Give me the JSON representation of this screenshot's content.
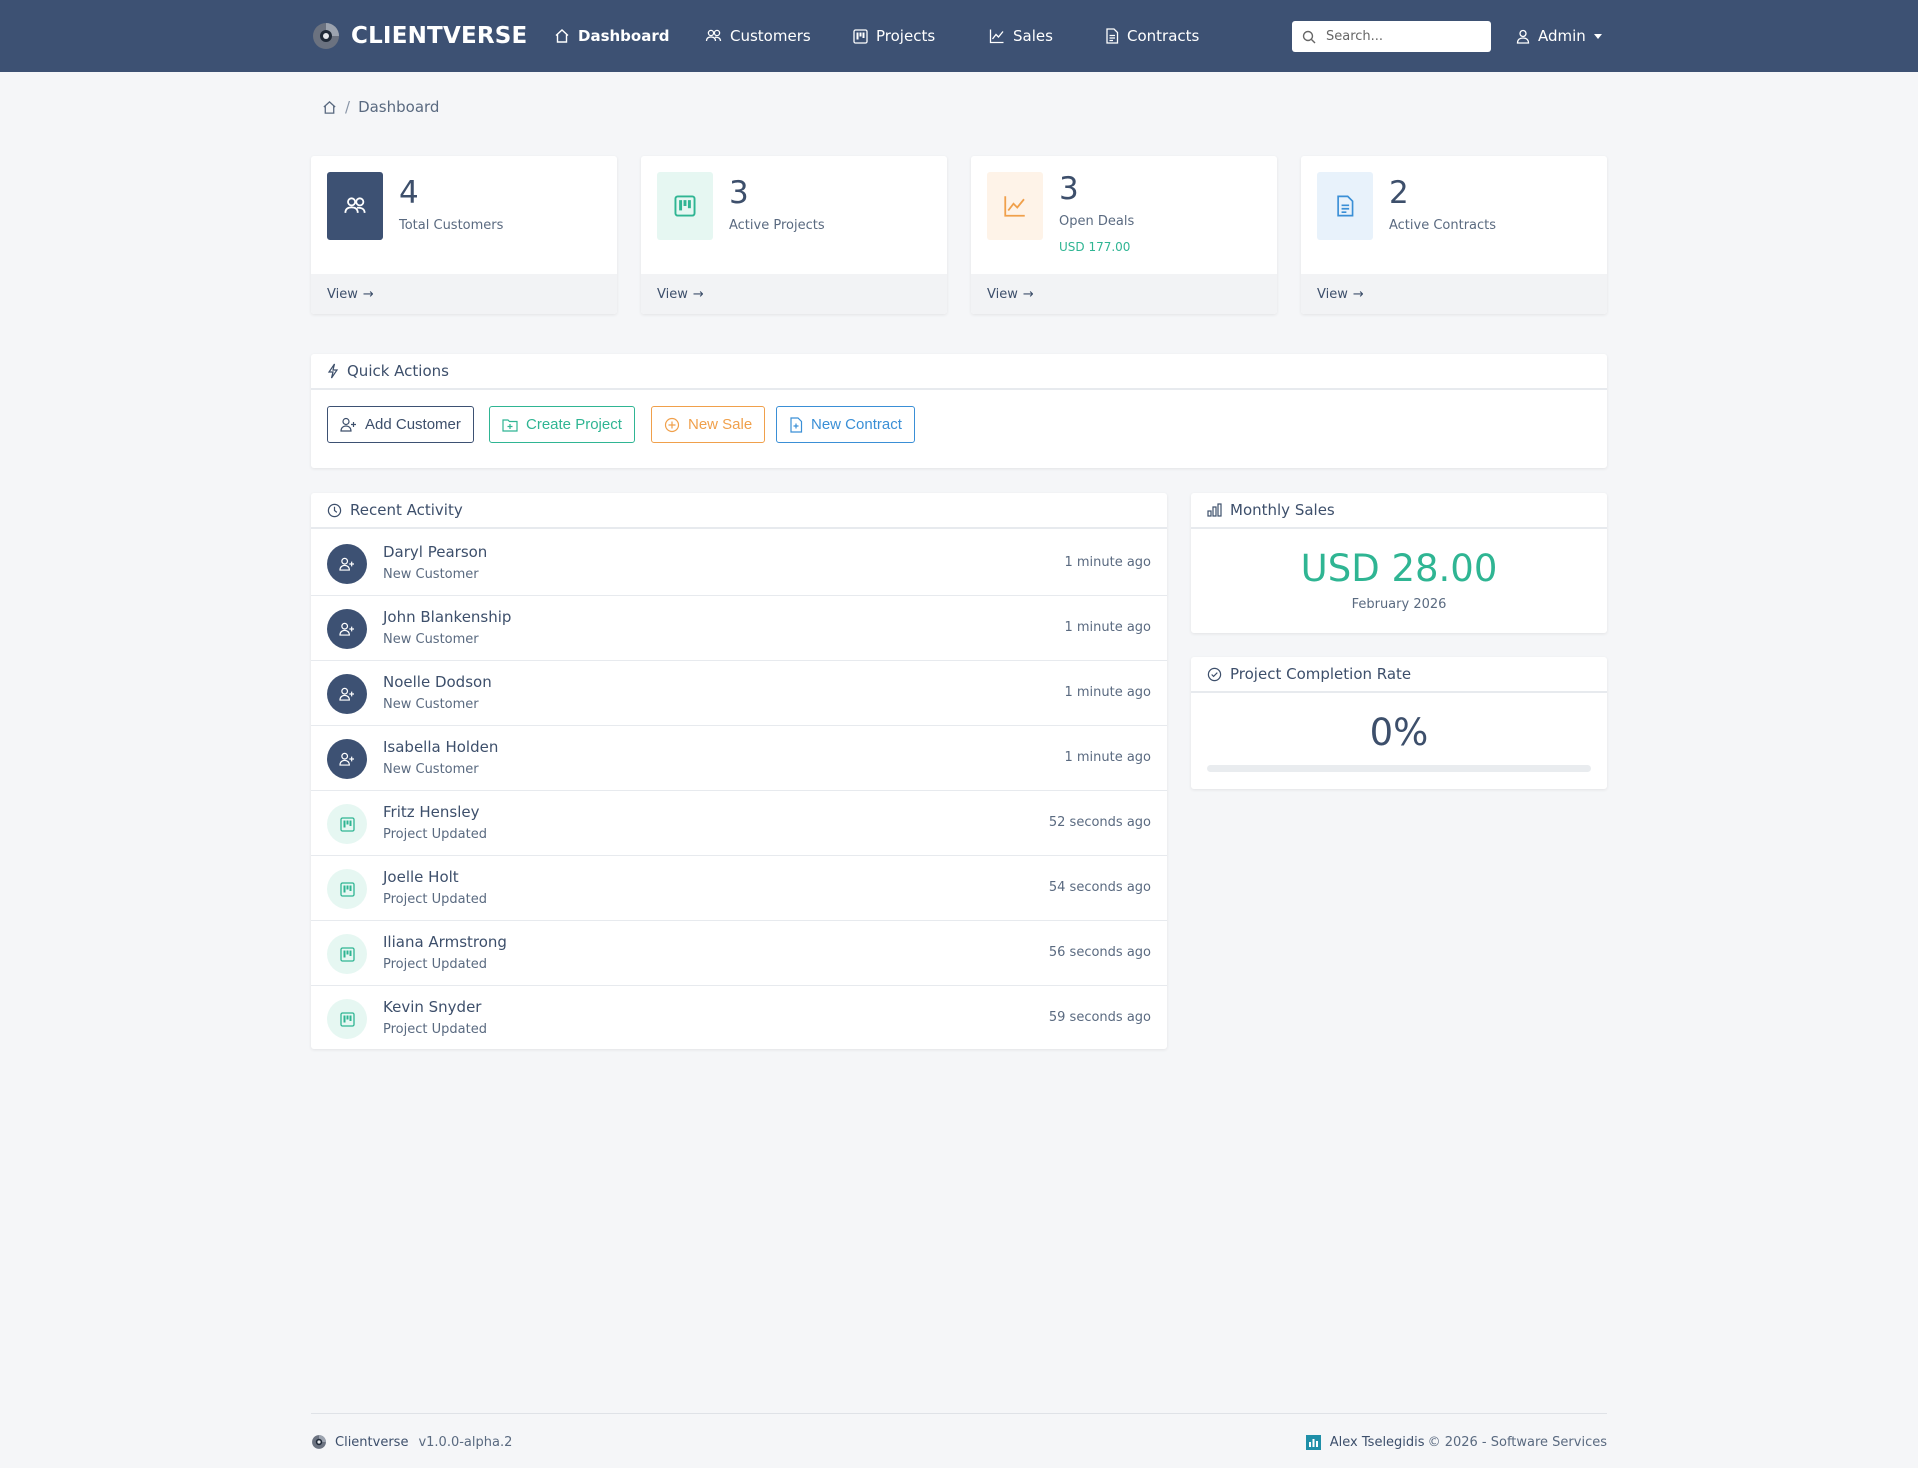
{
  "app": {
    "brand": "CLIENTVERSE",
    "nav": [
      {
        "label": "Dashboard",
        "icon": "home-icon",
        "active": true
      },
      {
        "label": "Customers",
        "icon": "users-icon"
      },
      {
        "label": "Projects",
        "icon": "kanban-icon"
      },
      {
        "label": "Sales",
        "icon": "chart-line-icon"
      },
      {
        "label": "Contracts",
        "icon": "document-icon"
      }
    ],
    "search_placeholder": "Search...",
    "user_menu": "Admin"
  },
  "breadcrumb": {
    "current": "Dashboard"
  },
  "stats": [
    {
      "value": "4",
      "label": "Total Customers",
      "link": "View",
      "color": "#3d5173"
    },
    {
      "value": "3",
      "label": "Active Projects",
      "link": "View",
      "color": "#2fb593"
    },
    {
      "value": "3",
      "label": "Open Deals",
      "sub": "USD 177.00",
      "link": "View",
      "color": "#f0a04b"
    },
    {
      "value": "2",
      "label": "Active Contracts",
      "link": "View",
      "color": "#3a8fd6"
    }
  ],
  "quick_actions": {
    "title": "Quick Actions",
    "buttons": [
      "Add Customer",
      "Create Project",
      "New Sale",
      "New Contract"
    ]
  },
  "activity": {
    "title": "Recent Activity",
    "items": [
      {
        "name": "Daryl Pearson",
        "type": "New Customer",
        "time": "1 minute ago"
      },
      {
        "name": "John Blankenship",
        "type": "New Customer",
        "time": "1 minute ago"
      },
      {
        "name": "Noelle Dodson",
        "type": "New Customer",
        "time": "1 minute ago"
      },
      {
        "name": "Isabella Holden",
        "type": "New Customer",
        "time": "1 minute ago"
      },
      {
        "name": "Fritz Hensley",
        "type": "Project Updated",
        "time": "52 seconds ago"
      },
      {
        "name": "Joelle Holt",
        "type": "Project Updated",
        "time": "54 seconds ago"
      },
      {
        "name": "Iliana Armstrong",
        "type": "Project Updated",
        "time": "56 seconds ago"
      },
      {
        "name": "Kevin Snyder",
        "type": "Project Updated",
        "time": "59 seconds ago"
      }
    ]
  },
  "monthly_sales": {
    "title": "Monthly Sales",
    "value": "USD 28.00",
    "month": "February 2026"
  },
  "completion": {
    "title": "Project Completion Rate",
    "value": "0%",
    "percent": 0
  },
  "footer": {
    "app_name": "Clientverse",
    "version": "v1.0.0-alpha.2",
    "author": "Alex Tselegidis",
    "copyright": "© 2026 - Software Services"
  },
  "colors": {
    "primary": "#3d5173",
    "success": "#2fb593",
    "warning": "#f0a04b",
    "info": "#3a8fd6"
  }
}
